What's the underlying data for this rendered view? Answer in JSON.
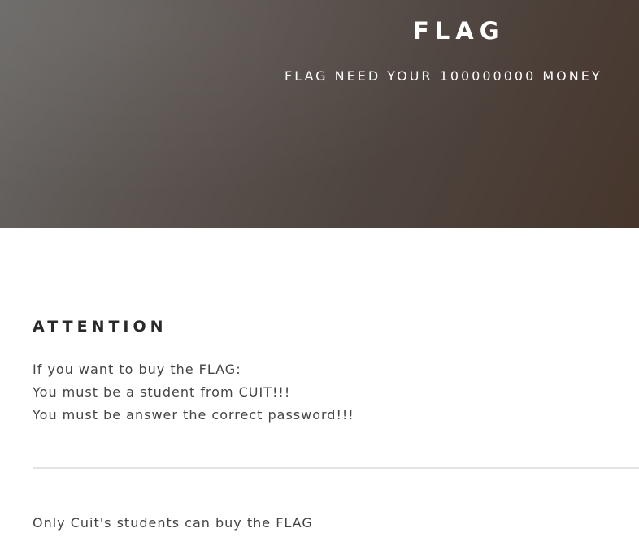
{
  "header": {
    "title": "FLAG",
    "subtitle": "FLAG NEED YOUR 100000000 MONEY"
  },
  "attention": {
    "heading": "ATTENTION",
    "lines": [
      "If you want to buy the FLAG:",
      "You must be a student from CUIT!!!",
      "You must be answer the correct password!!!"
    ]
  },
  "footer": {
    "text": "Only Cuit's students can buy the FLAG"
  },
  "colors": {
    "hero_dark": "#46362c",
    "hero_light": "#6a6866",
    "heading_text": "#2a2a2a",
    "body_text": "#444444",
    "divider": "#e3e3e3"
  }
}
